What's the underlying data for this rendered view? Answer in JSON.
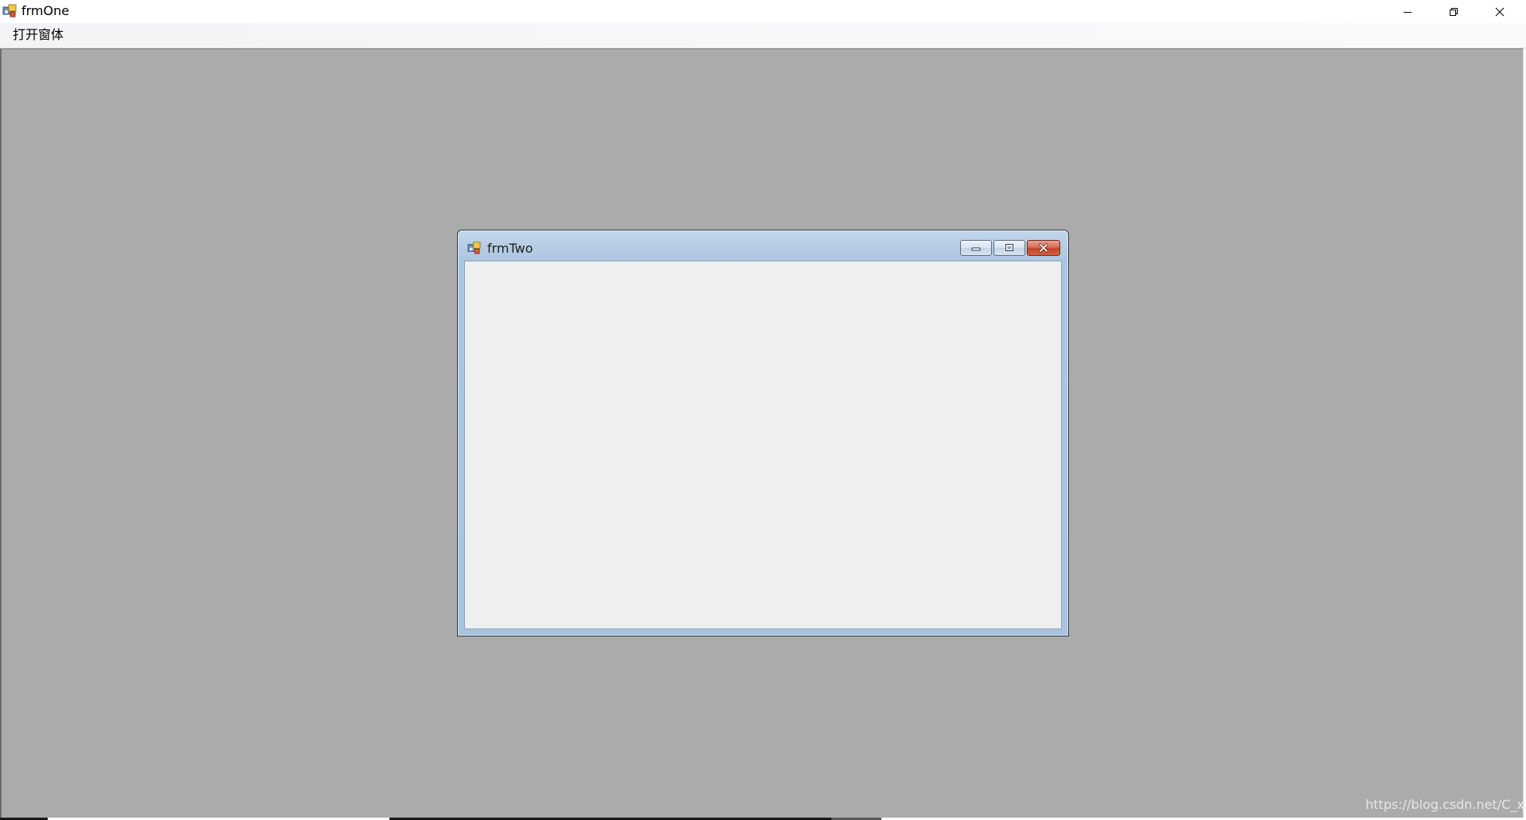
{
  "window": {
    "title": "frmOne",
    "icon": "app-form-icon",
    "controls": {
      "minimize": "minimize-icon",
      "restore": "restore-icon",
      "close": "close-icon"
    }
  },
  "menubar": {
    "items": [
      {
        "label": "打开窗体"
      }
    ]
  },
  "child_window": {
    "title": "frmTwo",
    "icon": "app-form-icon",
    "controls": {
      "minimize": "minimize-icon",
      "maximize": "maximize-icon",
      "close": "close-icon"
    }
  },
  "watermark": {
    "text": "https://blog.csdn.net/C_xxy"
  },
  "colors": {
    "mdi_background": "#ababab",
    "child_frame": "#aac4df",
    "child_client": "#efefef",
    "close_red": "#c2442a"
  }
}
